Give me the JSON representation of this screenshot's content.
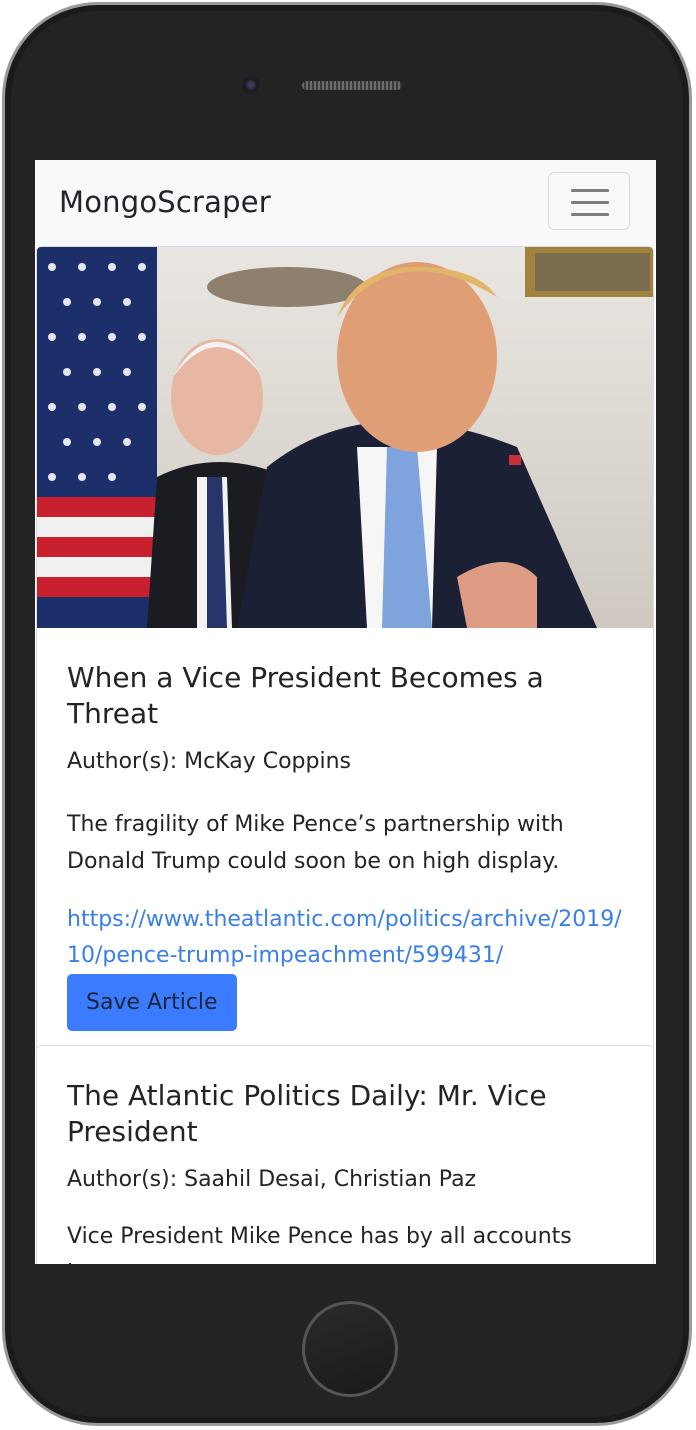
{
  "navbar": {
    "brand": "MongoScraper",
    "toggler_icon": "hamburger-menu-icon"
  },
  "articles": [
    {
      "image_alt": "Mike Pence standing behind Donald Trump",
      "title": "When a Vice President Becomes a Threat",
      "author": "Author(s): McKay Coppins",
      "summary": "The fragility of Mike Pence’s partnership with Donald Trump could soon be on high display.",
      "link": "https://www.theatlantic.com/politics/archive/2019/10/pence-trump-impeachment/599431/",
      "save_label": "Save Article"
    },
    {
      "title": "The Atlantic Politics Daily: Mr. Vice President",
      "author": "Author(s): Saahil Desai, Christian Paz",
      "summary": "Vice President Mike Pence has by all accounts been"
    }
  ],
  "colors": {
    "accent": "#3a7bff",
    "link": "#3a7fe6",
    "navbar_bg": "#f8f9fa",
    "phone_body": "#232323"
  }
}
